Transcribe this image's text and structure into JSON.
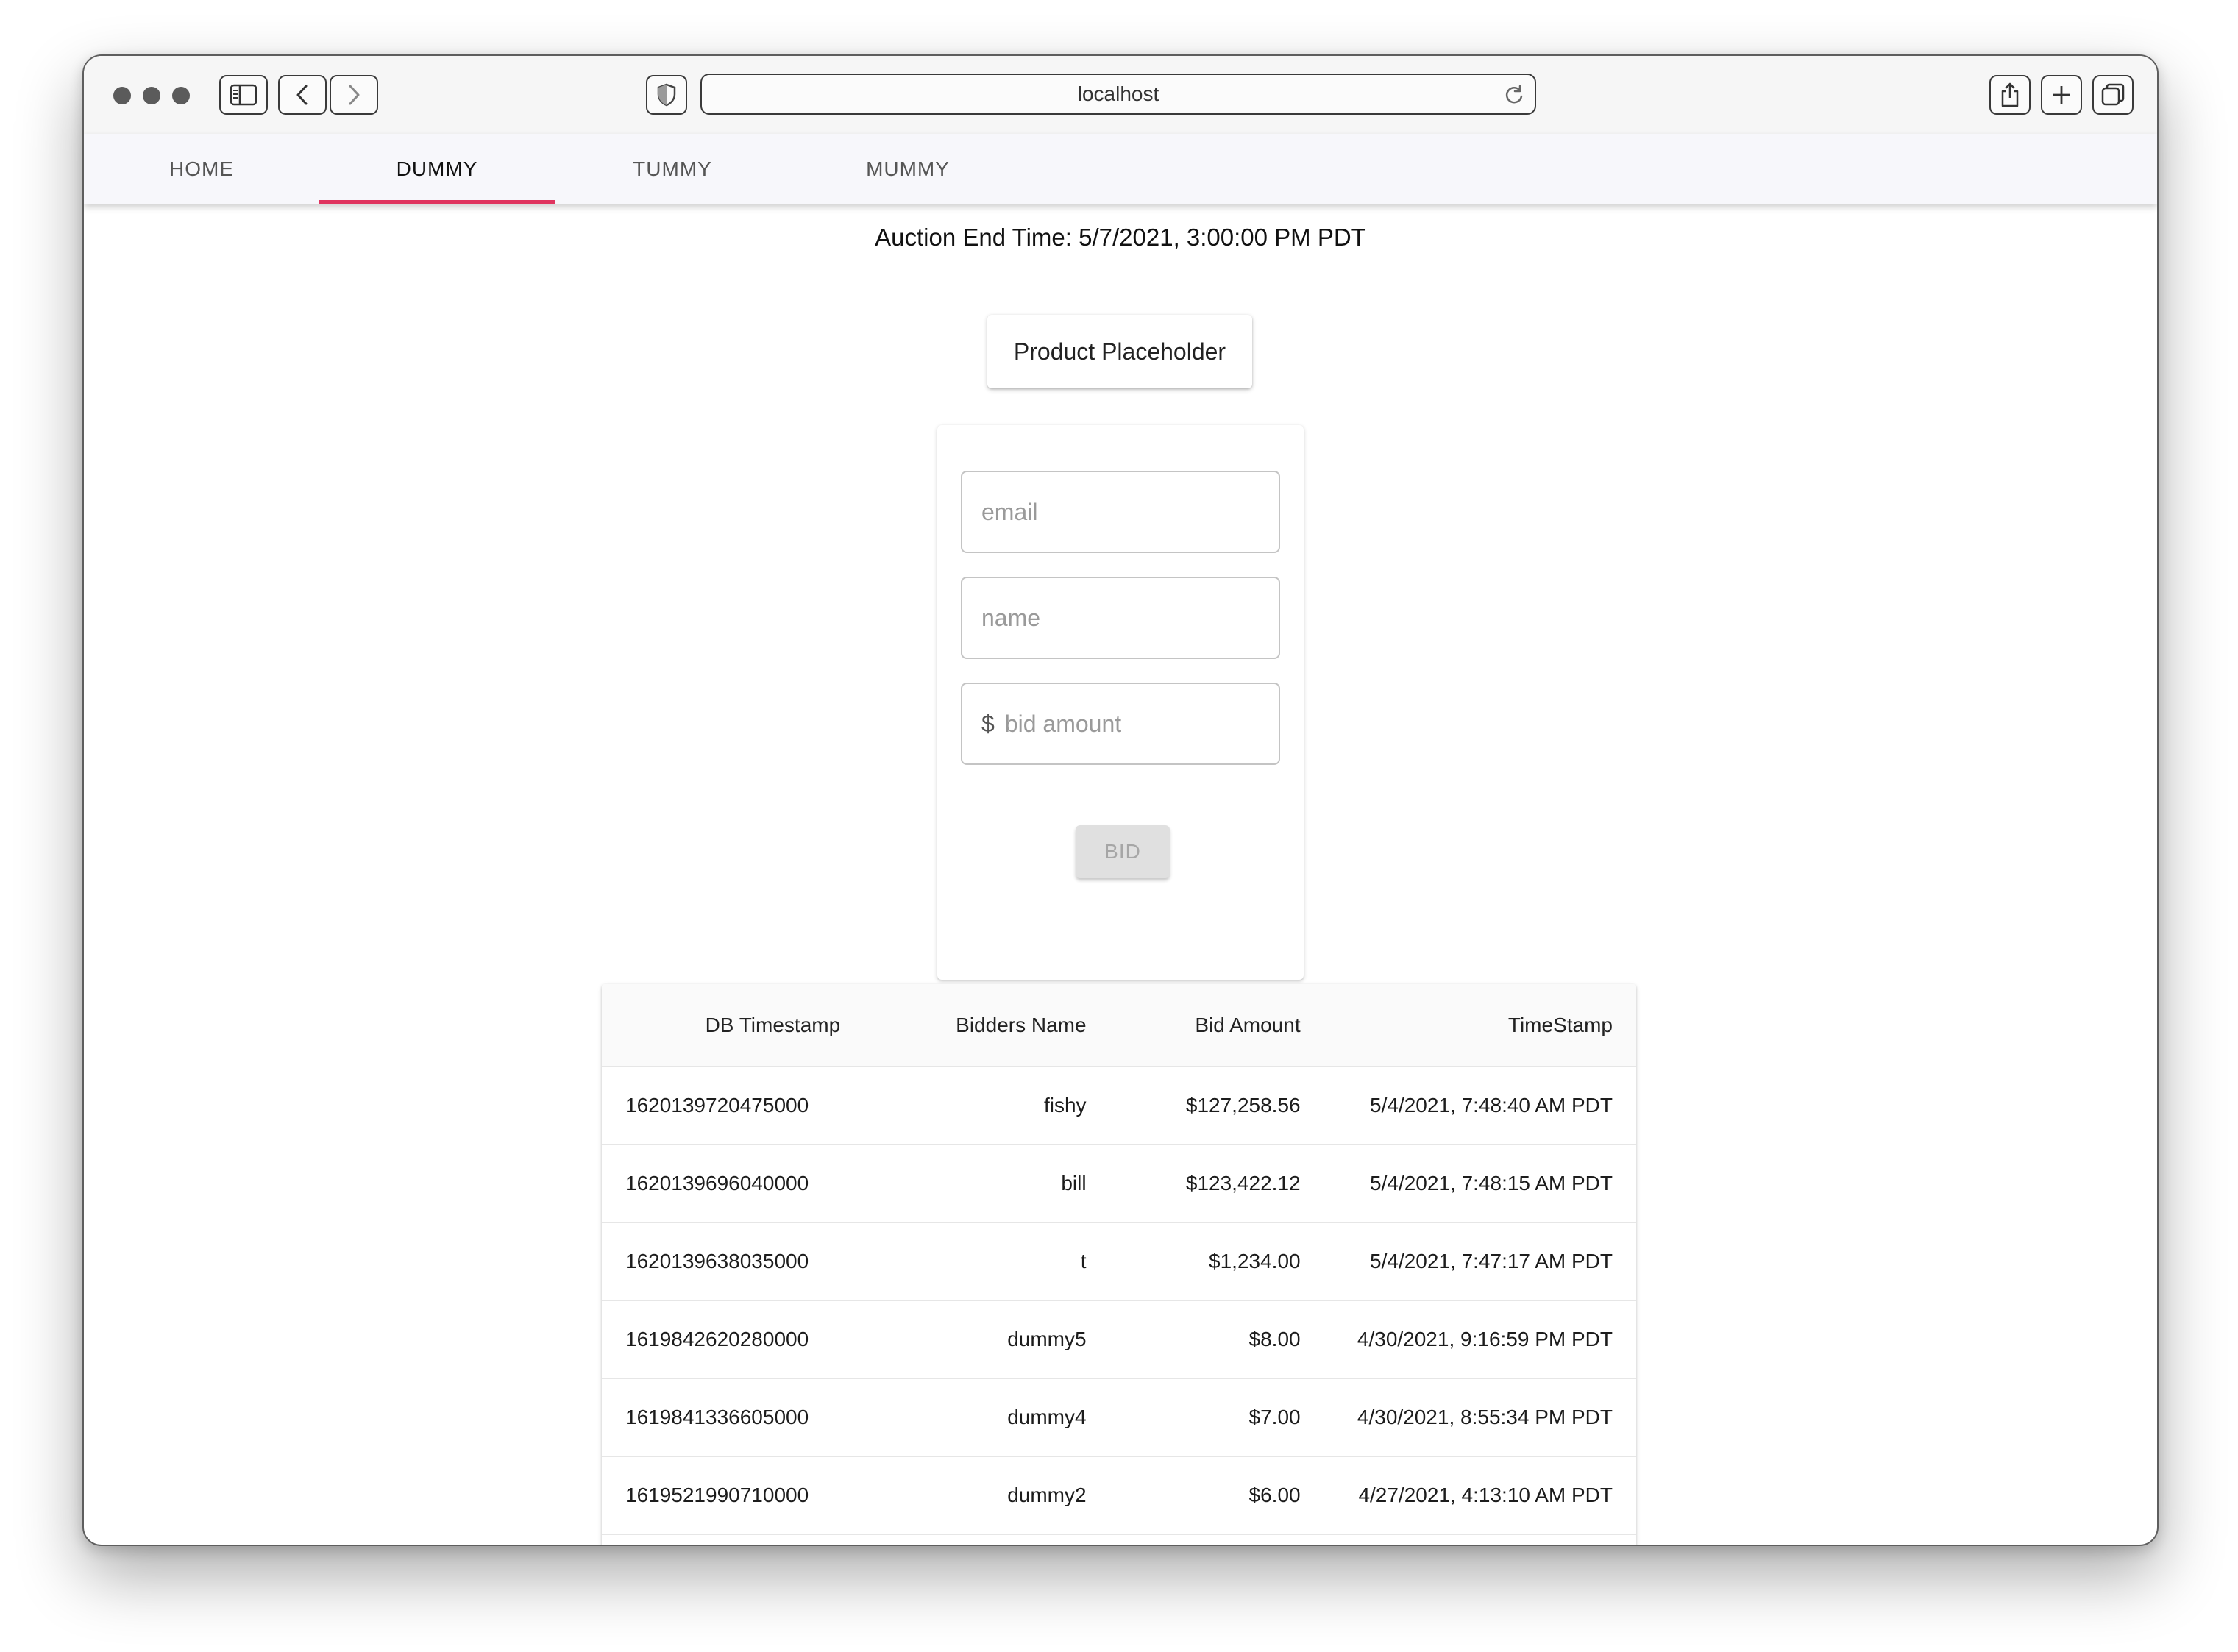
{
  "browser": {
    "url": "localhost"
  },
  "nav": {
    "tabs": [
      {
        "label": "HOME"
      },
      {
        "label": "DUMMY"
      },
      {
        "label": "TUMMY"
      },
      {
        "label": "MUMMY"
      }
    ],
    "active_tab": "DUMMY",
    "indicator_color": "#e0345f"
  },
  "auction": {
    "end_time": "Auction End Time: 5/7/2021, 3:00:00 PM PDT"
  },
  "product": {
    "label": "Product Placeholder"
  },
  "form": {
    "email_placeholder": "email",
    "name_placeholder": "name",
    "bid_prefix": "$",
    "bid_placeholder": "bid amount",
    "bid_button": "BID"
  },
  "bids_table": {
    "headers": [
      "DB Timestamp",
      "Bidders Name",
      "Bid Amount",
      "TimeStamp"
    ],
    "rows": [
      [
        "1620139720475000",
        "fishy",
        "$127,258.56",
        "5/4/2021, 7:48:40 AM PDT"
      ],
      [
        "1620139696040000",
        "bill",
        "$123,422.12",
        "5/4/2021, 7:48:15 AM PDT"
      ],
      [
        "1620139638035000",
        "t",
        "$1,234.00",
        "5/4/2021, 7:47:17 AM PDT"
      ],
      [
        "1619842620280000",
        "dummy5",
        "$8.00",
        "4/30/2021, 9:16:59 PM PDT"
      ],
      [
        "1619841336605000",
        "dummy4",
        "$7.00",
        "4/30/2021, 8:55:34 PM PDT"
      ],
      [
        "1619521990710000",
        "dummy2",
        "$6.00",
        "4/27/2021, 4:13:10 AM PDT"
      ]
    ]
  }
}
